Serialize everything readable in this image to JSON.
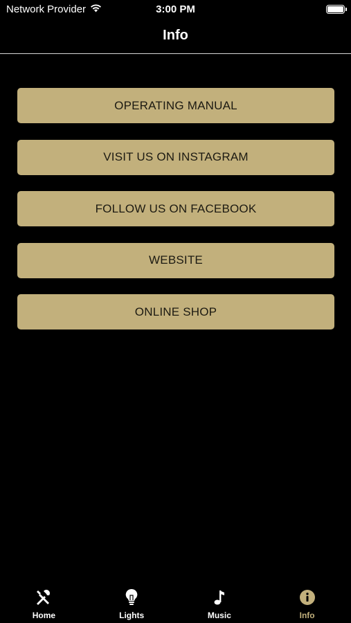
{
  "status_bar": {
    "carrier": "Network Provider",
    "time": "3:00 PM",
    "battery_level": 1.0
  },
  "nav": {
    "title": "Info"
  },
  "colors": {
    "button_bg": "#c2b07c",
    "button_text": "#1c1a12",
    "tab_active": "#c2b07c",
    "tab_inactive": "#ffffff"
  },
  "buttons": [
    {
      "label": "OPERATING MANUAL"
    },
    {
      "label": "VISIT US ON INSTAGRAM"
    },
    {
      "label": "FOLLOW US ON FACEBOOK"
    },
    {
      "label": "WEBSITE"
    },
    {
      "label": "ONLINE SHOP"
    }
  ],
  "tabs": [
    {
      "label": "Home",
      "icon": "tools-icon",
      "active": false
    },
    {
      "label": "Lights",
      "icon": "lightbulb-icon",
      "active": false
    },
    {
      "label": "Music",
      "icon": "music-note-icon",
      "active": false
    },
    {
      "label": "Info",
      "icon": "info-icon",
      "active": true
    }
  ]
}
